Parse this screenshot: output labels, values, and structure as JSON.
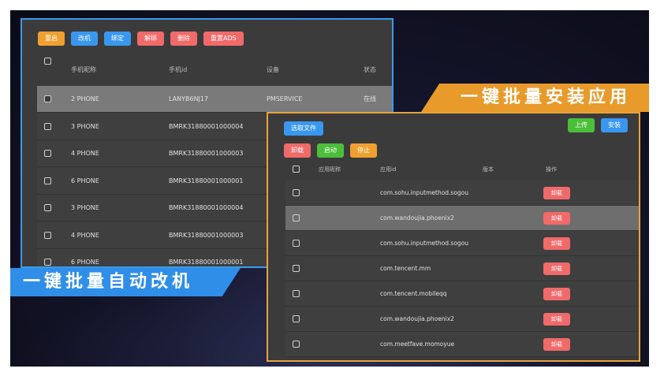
{
  "left_panel": {
    "toolbar": [
      {
        "label": "重启",
        "color": "#f0a030"
      },
      {
        "label": "改机",
        "color": "#3a97f0"
      },
      {
        "label": "绑定",
        "color": "#3a97f0"
      },
      {
        "label": "解绑",
        "color": "#f06a6a"
      },
      {
        "label": "删除",
        "color": "#f06a6a"
      },
      {
        "label": "重置ADS",
        "color": "#f06a6a"
      }
    ],
    "columns": {
      "name": "手机昵称",
      "id": "手机id",
      "device": "设备",
      "status": "状态"
    },
    "rows": [
      {
        "name": "2 PHONE",
        "id": "LANYB6NJ17",
        "device": "PMSERVICE",
        "status": "在线",
        "selected": true
      },
      {
        "name": "3 PHONE",
        "id": "BMRK31880001000004",
        "device": "",
        "status": "",
        "selected": false
      },
      {
        "name": "4 PHONE",
        "id": "BMRK31880001000003",
        "device": "",
        "status": "",
        "selected": false
      },
      {
        "name": "6 PHONE",
        "id": "BMRK31880001000001",
        "device": "",
        "status": "",
        "selected": false
      },
      {
        "name": "3 PHONE",
        "id": "BMRK31880001000004",
        "device": "",
        "status": "",
        "selected": false
      },
      {
        "name": "4 PHONE",
        "id": "BMRK31880001000003",
        "device": "",
        "status": "",
        "selected": false
      },
      {
        "name": "6 PHONE",
        "id": "BMRK31880001000001",
        "device": "",
        "status": "",
        "selected": false
      }
    ]
  },
  "right_panel": {
    "select_file": "选取文件",
    "upload": "上传",
    "install": "安装",
    "actions": [
      {
        "label": "卸载",
        "color": "#f06a6a"
      },
      {
        "label": "启动",
        "color": "#4bbf3a"
      },
      {
        "label": "停止",
        "color": "#f0a030"
      }
    ],
    "columns": {
      "app_name": "应用昵称",
      "app_id": "应用id",
      "version": "版本",
      "operation": "操作"
    },
    "row_button": "卸载",
    "rows": [
      {
        "app_id": "com.sohu.inputmethod.sogou",
        "selected": false
      },
      {
        "app_id": "com.wandoujia.phoenix2",
        "selected": true
      },
      {
        "app_id": "com.sohu.inputmethod.sogou",
        "selected": false
      },
      {
        "app_id": "com.tencent.mm",
        "selected": false
      },
      {
        "app_id": "com.tencent.mobileqq",
        "selected": false
      },
      {
        "app_id": "com.wandoujia.phoenix2",
        "selected": false
      },
      {
        "app_id": "com.meetfave.momoyue",
        "selected": false
      }
    ]
  },
  "banners": {
    "left": "一键批量自动改机",
    "right": "一键批量安装应用"
  },
  "colors": {
    "blue_accent": "#3a9ae8",
    "orange_accent": "#e8a33b",
    "panel_bg": "#3b3b3b"
  }
}
